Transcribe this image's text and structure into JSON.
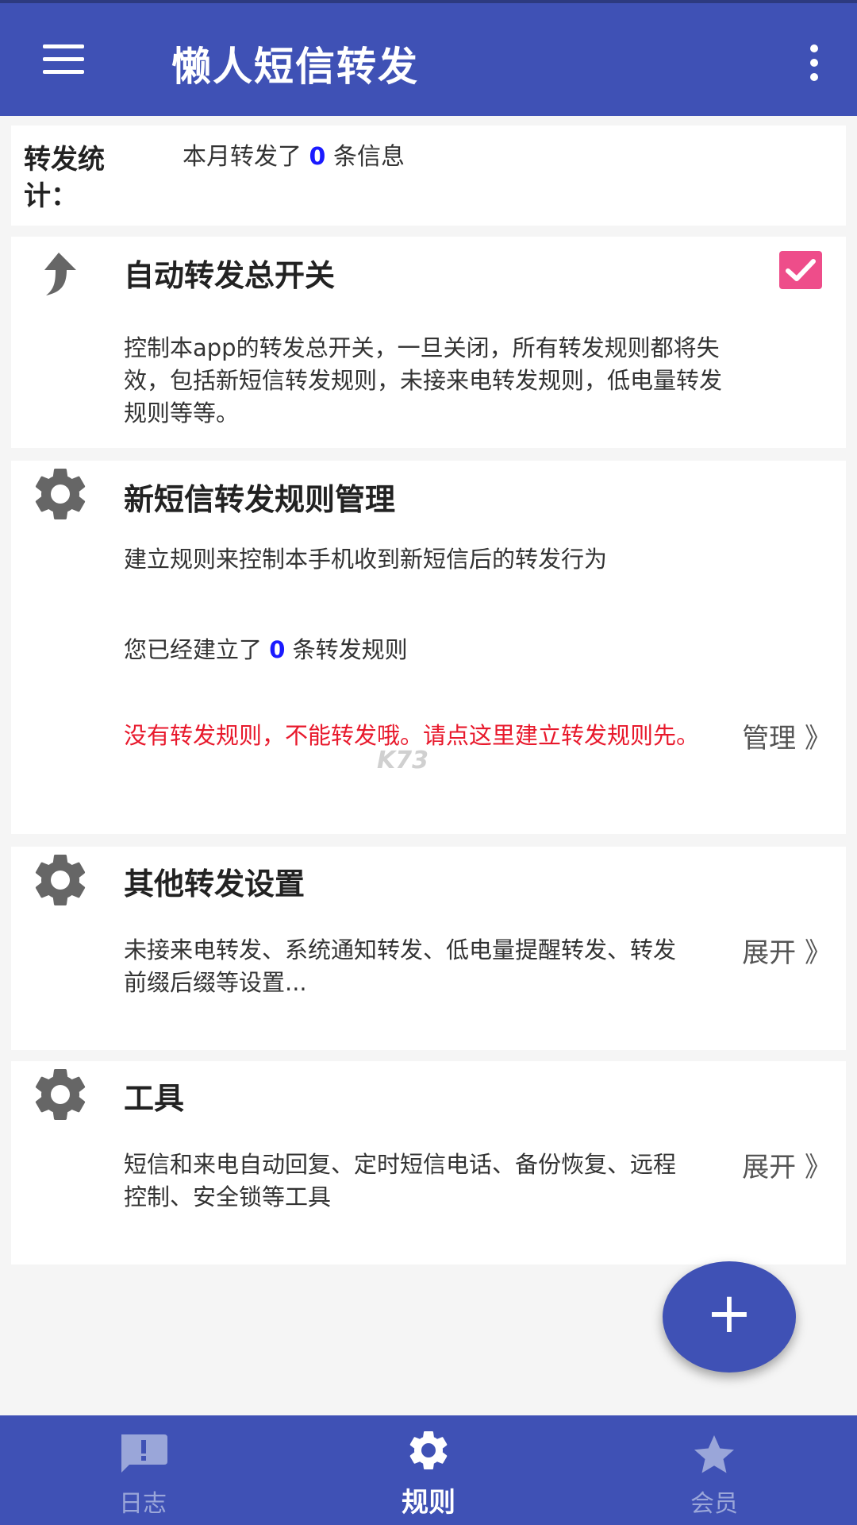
{
  "app": {
    "title": "懒人短信转发"
  },
  "stats": {
    "label": "转发统计：",
    "prefix": "本月转发了",
    "count": "0",
    "suffix": "条信息"
  },
  "master_switch": {
    "title": "自动转发总开关",
    "checked": true,
    "desc": "控制本app的转发总开关，一旦关闭，所有转发规则都将失效，包括新短信转发规则，未接来电转发规则，低电量转发规则等等。"
  },
  "sms_rules": {
    "title": "新短信转发规则管理",
    "desc": "建立规则来控制本手机收到新短信后的转发行为",
    "count_prefix": "您已经建立了",
    "count": "0",
    "count_suffix": "条转发规则",
    "warning": "没有转发规则，不能转发哦。请点这里建立转发规则先。",
    "link": "管理 》"
  },
  "other_settings": {
    "title": "其他转发设置",
    "desc": "未接来电转发、系统通知转发、低电量提醒转发、转发前缀后缀等设置...",
    "link": "展开 》"
  },
  "tools": {
    "title": "工具",
    "desc": "短信和来电自动回复、定时短信电话、备份恢复、远程控制、安全锁等工具",
    "link": "展开 》"
  },
  "fab": {
    "label": "+"
  },
  "watermark": "K73",
  "bottom_nav": [
    {
      "label": "日志",
      "icon": "feedback-icon",
      "active": false
    },
    {
      "label": "规则",
      "icon": "gear-icon",
      "active": true
    },
    {
      "label": "会员",
      "icon": "star-icon",
      "active": false
    }
  ],
  "colors": {
    "primary": "#3f51b5",
    "accent": "#ee4d8a",
    "warning": "#e8192c",
    "count": "#1a1aff"
  }
}
